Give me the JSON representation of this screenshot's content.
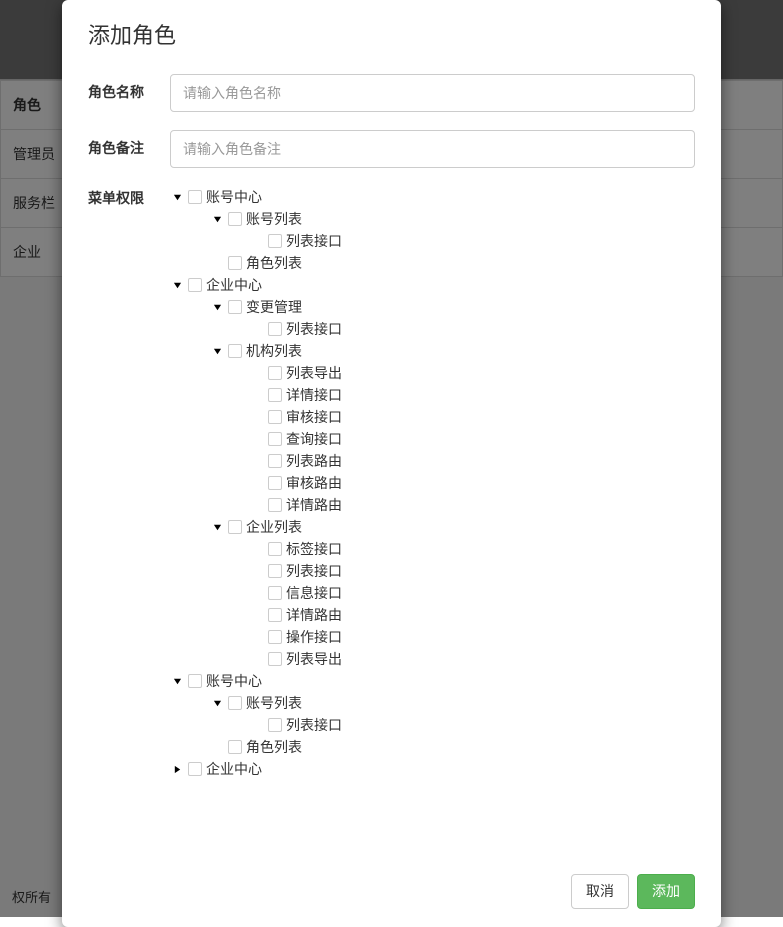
{
  "modal": {
    "title": "添加角色",
    "form": {
      "name_label": "角色名称",
      "name_placeholder": "请输入角色名称",
      "name_value": "",
      "remark_label": "角色备注",
      "remark_placeholder": "请输入角色备注",
      "remark_value": "",
      "perm_label": "菜单权限"
    },
    "footer": {
      "cancel": "取消",
      "submit": "添加"
    }
  },
  "tree": [
    {
      "label": "账号中心",
      "expanded": true,
      "children": [
        {
          "label": "账号列表",
          "expanded": true,
          "children": [
            {
              "label": "列表接口"
            }
          ]
        },
        {
          "label": "角色列表"
        }
      ]
    },
    {
      "label": "企业中心",
      "expanded": true,
      "children": [
        {
          "label": "变更管理",
          "expanded": true,
          "children": [
            {
              "label": "列表接口"
            }
          ]
        },
        {
          "label": "机构列表",
          "expanded": true,
          "children": [
            {
              "label": "列表导出"
            },
            {
              "label": "详情接口"
            },
            {
              "label": "审核接口"
            },
            {
              "label": "查询接口"
            },
            {
              "label": "列表路由"
            },
            {
              "label": "审核路由"
            },
            {
              "label": "详情路由"
            }
          ]
        },
        {
          "label": "企业列表",
          "expanded": true,
          "children": [
            {
              "label": "标签接口"
            },
            {
              "label": "列表接口"
            },
            {
              "label": "信息接口"
            },
            {
              "label": "详情路由"
            },
            {
              "label": "操作接口"
            },
            {
              "label": "列表导出"
            }
          ]
        }
      ]
    },
    {
      "label": "账号中心",
      "expanded": true,
      "children": [
        {
          "label": "账号列表",
          "expanded": true,
          "children": [
            {
              "label": "列表接口"
            }
          ]
        },
        {
          "label": "角色列表"
        }
      ]
    },
    {
      "label": "企业中心",
      "expanded": false,
      "children": []
    }
  ],
  "background": {
    "table": {
      "header": "角色",
      "rows": [
        "管理员",
        "服务栏",
        "企业"
      ]
    },
    "footer_text": "权所有"
  }
}
